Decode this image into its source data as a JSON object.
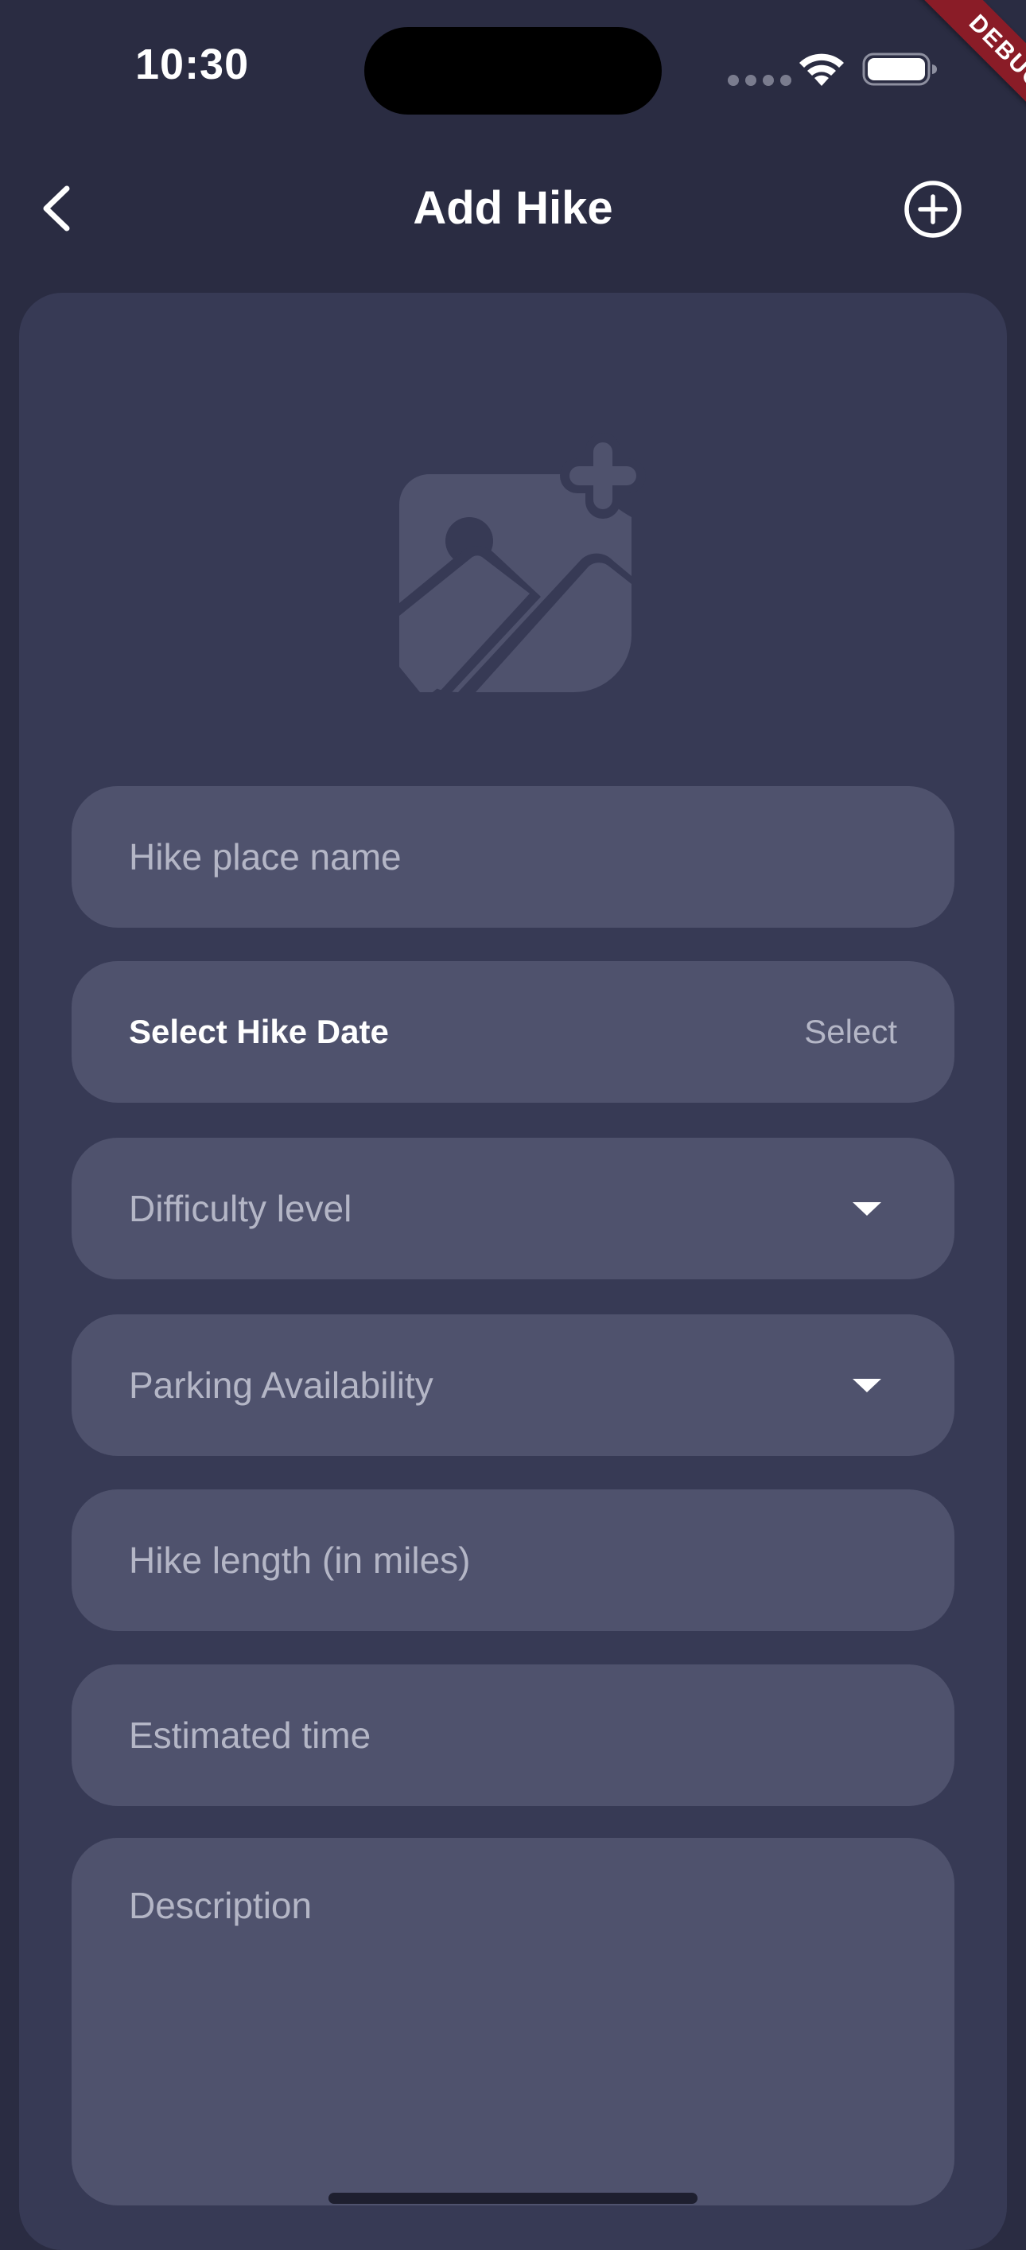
{
  "status_bar": {
    "time": "10:30",
    "icons": [
      "signal-icon",
      "wifi-icon",
      "battery-icon"
    ]
  },
  "debug_banner": "DEBUG",
  "app_bar": {
    "title": "Add Hike",
    "back_icon": "chevron-left-icon",
    "action_icon": "add-circle-icon"
  },
  "image_picker": {
    "icon": "add-photo-icon"
  },
  "form": {
    "hike_name_placeholder": "Hike place name",
    "date_label": "Select Hike Date",
    "date_action": "Select",
    "difficulty_placeholder": "Difficulty level",
    "parking_placeholder": "Parking Availability",
    "length_placeholder": "Hike length (in miles)",
    "time_placeholder": "Estimated time",
    "description_placeholder": "Description"
  },
  "colors": {
    "background": "#2a2c42",
    "card": "#373a55",
    "field": "#4f526d",
    "placeholder": "#b4b6c6",
    "debug": "#8a1c27"
  }
}
